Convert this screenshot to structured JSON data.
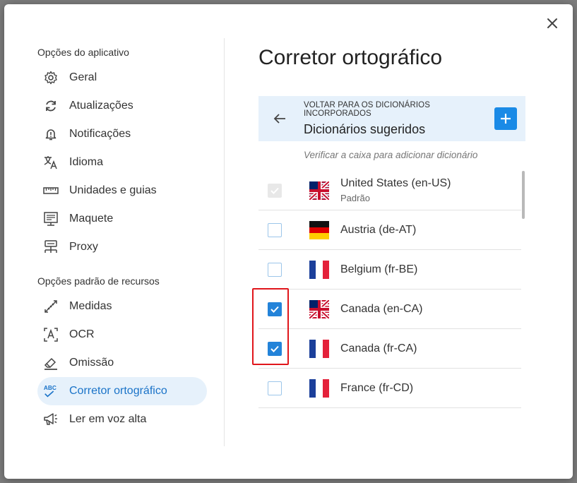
{
  "dialog": {
    "close_icon": "close-icon"
  },
  "sidebar": {
    "section1_title": "Opções do aplicativo",
    "section1_items": [
      {
        "label": "Geral",
        "icon": "gear-icon"
      },
      {
        "label": "Atualizações",
        "icon": "refresh-icon"
      },
      {
        "label": "Notificações",
        "icon": "bell-icon"
      },
      {
        "label": "Idioma",
        "icon": "translate-icon"
      },
      {
        "label": "Unidades e guias",
        "icon": "ruler-icon"
      },
      {
        "label": "Maquete",
        "icon": "layout-icon"
      },
      {
        "label": "Proxy",
        "icon": "network-icon"
      }
    ],
    "section2_title": "Opções padrão de recursos",
    "section2_items": [
      {
        "label": "Medidas",
        "icon": "measure-icon"
      },
      {
        "label": "OCR",
        "icon": "ocr-icon"
      },
      {
        "label": "Omissão",
        "icon": "eraser-icon"
      },
      {
        "label": "Corretor ortográfico",
        "icon": "spellcheck-icon",
        "active": true
      },
      {
        "label": "Ler em voz alta",
        "icon": "megaphone-icon"
      }
    ]
  },
  "main": {
    "title": "Corretor ortográfico",
    "back_bar": {
      "small_label": "VOLTAR PARA OS DICIONÁRIOS INCORPORADOS",
      "big_label": "Dicionários sugeridos"
    },
    "hint": "Verificar a caixa para adicionar dicionário",
    "dictionaries": [
      {
        "label": "United States (en-US)",
        "sub": "Padrão",
        "state": "disabled",
        "flag": "us-flag-icon"
      },
      {
        "label": "Austria (de-AT)",
        "sub": "",
        "state": "unchecked",
        "flag": "germany-flag-icon"
      },
      {
        "label": "Belgium (fr-BE)",
        "sub": "",
        "state": "unchecked",
        "flag": "france-flag-icon"
      },
      {
        "label": "Canada (en-CA)",
        "sub": "",
        "state": "checked",
        "flag": "us-flag-icon"
      },
      {
        "label": "Canada (fr-CA)",
        "sub": "",
        "state": "checked",
        "flag": "france-flag-icon"
      },
      {
        "label": "France (fr-CD)",
        "sub": "",
        "state": "unchecked",
        "flag": "france-flag-icon"
      }
    ]
  },
  "colors": {
    "accent": "#1a8ae6",
    "active_bg": "#e6f1fb",
    "highlight": "#e0161b"
  }
}
